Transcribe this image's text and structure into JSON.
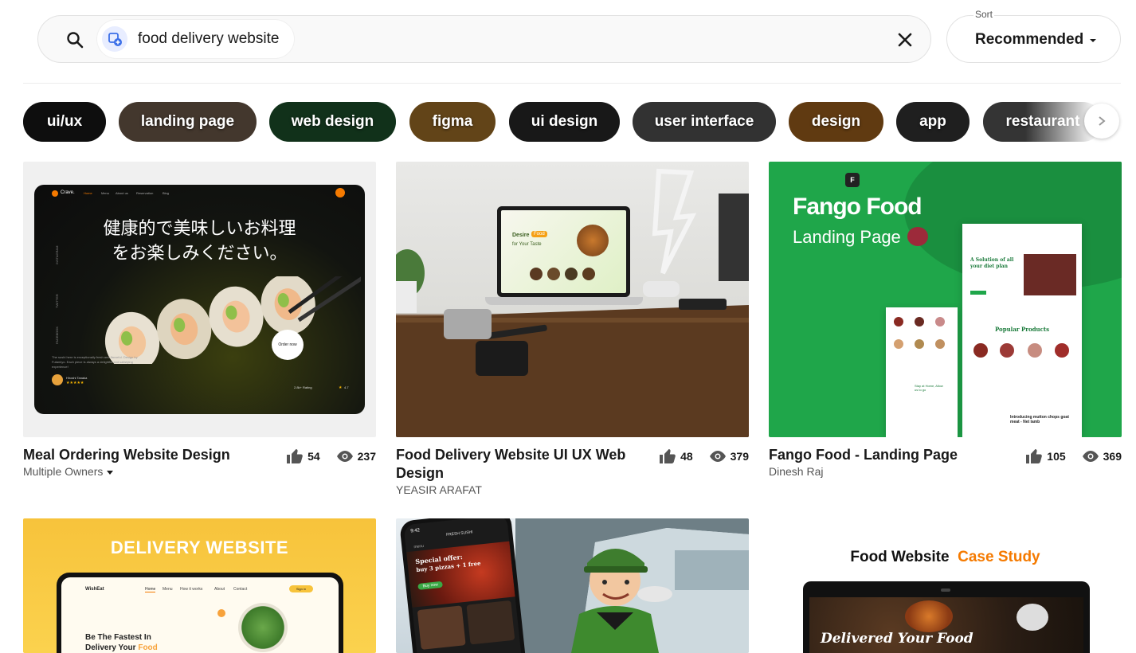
{
  "search": {
    "query": "food delivery website"
  },
  "sort": {
    "label": "Sort",
    "value": "Recommended"
  },
  "tags": [
    {
      "label": "ui/ux",
      "color": "#1a1a1a"
    },
    {
      "label": "landing page",
      "color": "#6b5a4a"
    },
    {
      "label": "web design",
      "color": "#1d4d2a"
    },
    {
      "label": "figma",
      "color": "#b07a2a"
    },
    {
      "label": "ui design",
      "color": "#2a2a2a"
    },
    {
      "label": "user interface",
      "color": "#555555"
    },
    {
      "label": "design",
      "color": "#a8631c"
    },
    {
      "label": "app",
      "color": "#3a3a3a"
    },
    {
      "label": "restaurant",
      "color": "#5a5a5a"
    }
  ],
  "projects": [
    {
      "title": "Meal Ordering Website Design",
      "owner": "Multiple Owners",
      "likes": "54",
      "views": "237",
      "thumb": {
        "brand": "Crave.",
        "nav": [
          "Home",
          "Menu",
          "About us",
          "Reservation",
          "Blog"
        ],
        "jp_line1": "健康的で美味しいお料理",
        "jp_line2": "をお楽しみください。",
        "side": [
          "INSTAGRAM",
          "TWITTER",
          "FACEBOOK"
        ],
        "order_label": "Order now",
        "desc": "The sushi here is exceptionally fresh and flavorful. Design by Futamiyo. Each piece is always a delightful and satisfying experience!",
        "reviewer": "Hiroshi Tanaka",
        "rating_text": "2.8k+ Rating",
        "rating_value": "4.7"
      }
    },
    {
      "title": "Food Delivery Website UI UX Web Design",
      "owner": "YEASIR ARAFAT",
      "likes": "48",
      "views": "379",
      "thumb": {
        "screen_title": "Desire",
        "screen_word": "Food",
        "screen_sub": "for Your Taste"
      }
    },
    {
      "title": "Fango Food - Landing Page",
      "owner": "Dinesh Raj",
      "likes": "105",
      "views": "369",
      "thumb": {
        "headline": "Fango Food",
        "sub": "Landing Page",
        "mock_heading": "A Solution of all your diet plan",
        "mock_popular": "Popular Products",
        "mock_intro": "Introducing mutton chops goat meat - Net lamb",
        "mock_stay": "Stay at Home, Allow us to go"
      }
    },
    {
      "title": "",
      "owner": "",
      "likes": "",
      "views": "",
      "thumb": {
        "headline": "DELIVERY WEBSITE",
        "brand": "WishEat",
        "nav": [
          "Home",
          "Menu",
          "How it works",
          "About",
          "Contact"
        ],
        "signin": "Sign in",
        "hero": "Be The Fastest In",
        "hero2": "Delivery Your",
        "hero2_accent": "Food"
      }
    },
    {
      "title": "",
      "owner": "",
      "likes": "",
      "views": "",
      "thumb": {
        "time": "9:42",
        "app_name": "FRESH SUSHI",
        "menu_label": "menu",
        "offer1": "Special offer:",
        "offer2": "buy 3 pizzas + 1 free",
        "buy_label": "Buy now"
      }
    },
    {
      "title": "",
      "owner": "",
      "likes": "",
      "views": "",
      "thumb": {
        "headline": "Food Website",
        "headline_accent": "Case Study",
        "tagline": "Delivered Your Food"
      }
    }
  ],
  "colors": {
    "accent_orange": "#f57a00",
    "fango_green": "#1fa64a",
    "delivery_yellow": "#f7c33b"
  }
}
